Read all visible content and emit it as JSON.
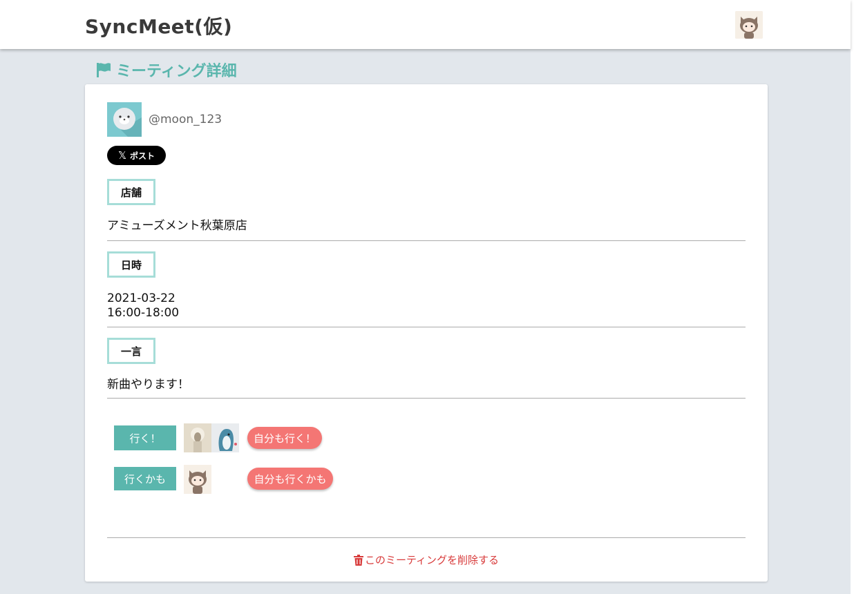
{
  "header": {
    "app_title": "SyncMeet(仮)",
    "avatar_icon": "cat-avatar-icon"
  },
  "page": {
    "heading": "ミーティング詳細",
    "heading_icon": "flag-icon",
    "accent_color": "#5ab6ad"
  },
  "meeting": {
    "organizer": {
      "username": "@moon_123",
      "avatar_icon": "seal-avatar-icon"
    },
    "share_button_label": "ポスト",
    "share_icon": "x-logo-icon",
    "store": {
      "label": "店舗",
      "value": "アミューズメント秋葉原店"
    },
    "datetime": {
      "label": "日時",
      "date": "2021-03-22",
      "time": "16:00-18:00"
    },
    "comment": {
      "label": "一言",
      "value": "新曲やります！"
    }
  },
  "attendance": {
    "going": {
      "label": "行く！",
      "avatars": [
        "sheep-avatar-icon",
        "penguin-avatar-icon"
      ],
      "button_label": "自分も行く！"
    },
    "maybe": {
      "label": "行くかも",
      "avatars": [
        "cat-avatar-icon"
      ],
      "button_label": "自分も行くかも"
    },
    "button_color": "#f47674"
  },
  "delete": {
    "label": "このミーティングを削除する",
    "icon": "trash-icon",
    "color": "#d83a3a"
  }
}
